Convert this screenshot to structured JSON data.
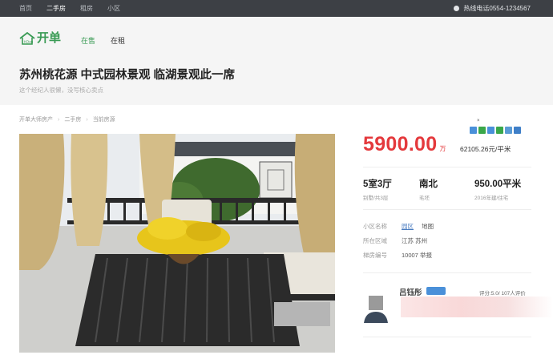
{
  "topbar": {
    "nav": [
      "首页",
      "二手房",
      "租房",
      "小区"
    ],
    "active_index": 1,
    "hotline": "热线电话0554-1234567"
  },
  "header": {
    "logo_text": "开单",
    "tabs": [
      "在售",
      "在租"
    ],
    "active_tab": 0,
    "title": "苏州桃花源  中式园林景观  临湖景观此一席",
    "subtitle": "这个经纪人很懒，没写核心卖点"
  },
  "breadcrumb": [
    "开单大师房产",
    "二手房",
    "当前房源"
  ],
  "share": {
    "close_glyph": "×"
  },
  "price": {
    "total": "5900.00",
    "total_unit": "万",
    "unit_price": "62105.26元/平米"
  },
  "attributes": [
    {
      "main": "5室3厅",
      "sub": "别墅/共3层"
    },
    {
      "main": "南北",
      "sub": "毛坯"
    },
    {
      "main": "950.00平米",
      "sub": "2016年建/住宅"
    }
  ],
  "info": {
    "community": {
      "label": "小区名称",
      "value": "园区",
      "map_link": "地图"
    },
    "region": {
      "label": "所在区域",
      "value": "江苏  苏州"
    },
    "listing": {
      "label": "梯房编号",
      "value": "10007 举报"
    }
  },
  "agent": {
    "name": "吕钰彤",
    "rating": "评分:5.0/ 107人评价"
  },
  "colors": {
    "accent_green": "#3a9b55",
    "price_red": "#e4393c",
    "topbar_bg": "#3d4045",
    "header_bg": "#f5f5f5"
  }
}
